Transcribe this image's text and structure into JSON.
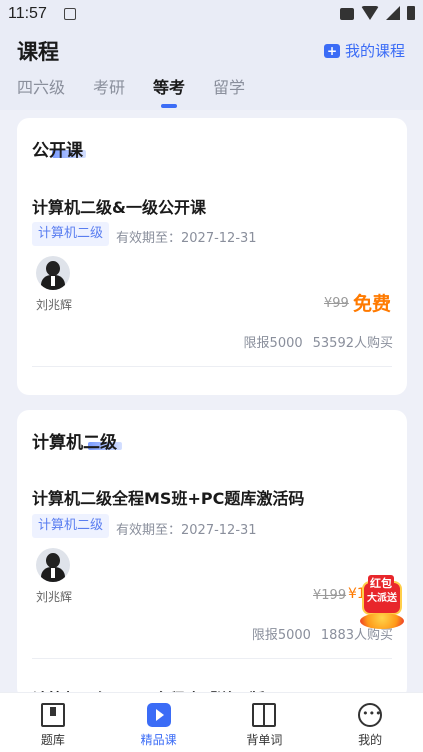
{
  "status_bar": {
    "time": "11:57"
  },
  "header": {
    "title": "课程",
    "my_course_label": "我的课程",
    "tabs": [
      "四六级",
      "考研",
      "等考",
      "留学"
    ],
    "active_tab": "等考"
  },
  "sections": [
    {
      "title": "公开课",
      "course": {
        "name": "计算机二级&一级公开课",
        "tag": "计算机二级",
        "validity": "有效期至：2027-12-31",
        "teacher": "刘兆辉",
        "old_price": "¥99",
        "price": "免费",
        "quota": "限报5000",
        "buyers": "53592人购买"
      }
    },
    {
      "title": "计算机二级",
      "course": {
        "name": "计算机二级全程MS班+PC题库激活码",
        "tag": "计算机二级",
        "validity": "有效期至：2027-12-31",
        "teacher": "刘兆辉",
        "old_price": "¥199",
        "price": "¥1",
        "quota": "限报5000",
        "buyers": "1883人购买"
      },
      "next_course_peek": "计算机二级WPS全程班【送正版"
    }
  ],
  "floating_badge": {
    "line1": "红包",
    "line2": "大派送"
  },
  "bottom_nav": [
    {
      "label": "题库",
      "icon": "question-bank-icon",
      "active": false
    },
    {
      "label": "精品课",
      "icon": "play-icon",
      "active": true
    },
    {
      "label": "背单词",
      "icon": "open-book-icon",
      "active": false
    },
    {
      "label": "我的",
      "icon": "chat-icon",
      "active": false
    }
  ],
  "colors": {
    "accent": "#3b6cf6",
    "price": "#ff7a00",
    "background": "#eef0f8"
  }
}
